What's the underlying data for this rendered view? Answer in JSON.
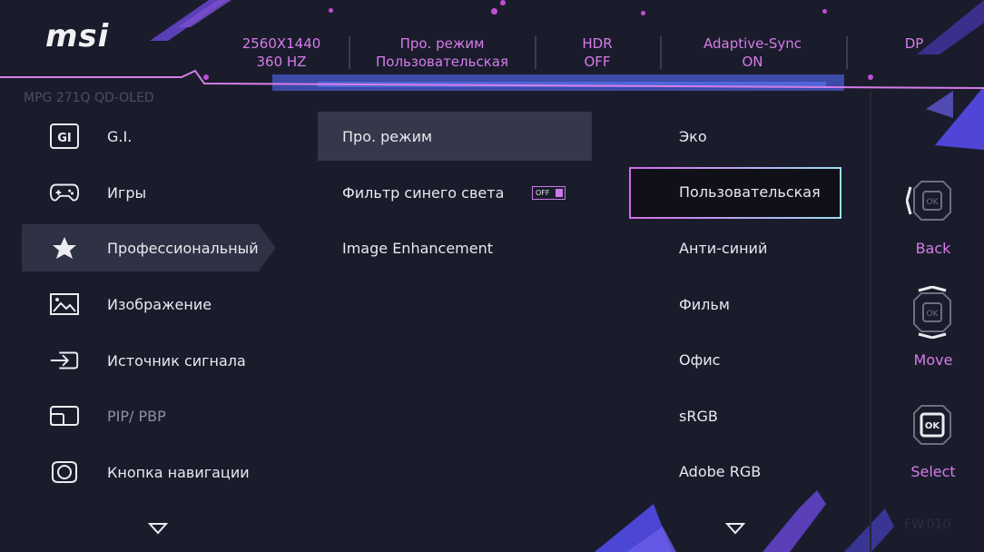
{
  "brand": "msi",
  "model": "MPG 271Q QD-OLED",
  "header": {
    "resolution": "2560X1440",
    "refresh": "360 HZ",
    "mode_title": "Про. режим",
    "mode_value": "Пользовательская",
    "hdr_title": "HDR",
    "hdr_value": "OFF",
    "sync_title": "Adaptive-Sync",
    "sync_value": "ON",
    "input": "DP"
  },
  "menu": {
    "items": [
      {
        "label": "G.I.",
        "icon": "gi-icon"
      },
      {
        "label": "Игры",
        "icon": "gamepad-icon"
      },
      {
        "label": "Профессиональный",
        "icon": "star-icon"
      },
      {
        "label": "Изображение",
        "icon": "image-icon"
      },
      {
        "label": "Источник сигнала",
        "icon": "input-source-icon"
      },
      {
        "label": "PIP/ PBP",
        "icon": "pip-icon"
      },
      {
        "label": "Кнопка навигации",
        "icon": "nav-key-icon"
      }
    ],
    "selected": "Профессиональный"
  },
  "submenu": {
    "items": [
      {
        "label": "Про. режим"
      },
      {
        "label": "Фильтр синего света"
      },
      {
        "label": "Image Enhancement"
      }
    ],
    "blue_light_toggle": "OFF"
  },
  "options": {
    "items": [
      "Эко",
      "Пользовательская",
      "Анти-синий",
      "Фильм",
      "Офис",
      "sRGB",
      "Adobe RGB"
    ],
    "selected": "Пользовательская"
  },
  "nav": {
    "back": "Back",
    "move": "Move",
    "select": "Select"
  },
  "firmware": "FW.010",
  "colors": {
    "accent": "#d77ce9",
    "background": "#1a1c2c",
    "highlight": "#35374a"
  }
}
